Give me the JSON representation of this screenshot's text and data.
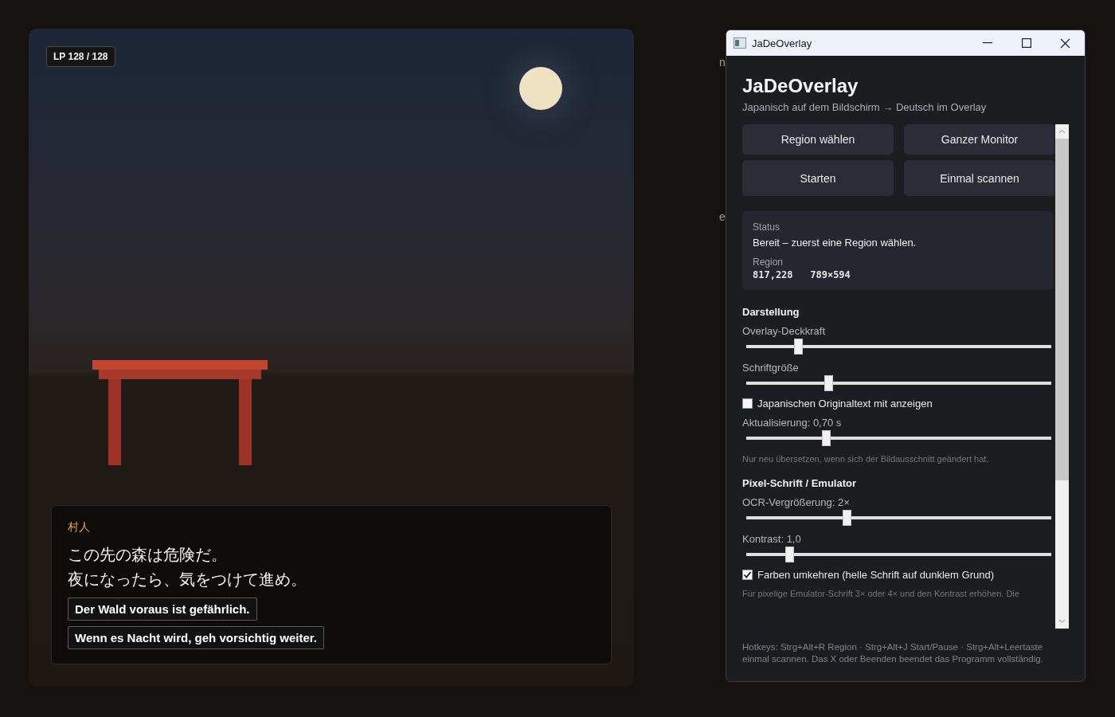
{
  "game": {
    "hp_badge": "LP 128 / 128",
    "dialog": {
      "speaker": "村人",
      "lines": [
        "この先の森は危険だ。",
        "夜になったら、気をつけて進め。"
      ],
      "translations": [
        "Der Wald voraus ist gefährlich.",
        "Wenn es Nacht wird, geh vorsichtig weiter."
      ]
    }
  },
  "background_fragments": [
    "n",
    "e"
  ],
  "window": {
    "title": "JaDeOverlay",
    "app_title": "JaDeOverlay",
    "subtitle": "Japanisch auf dem Bildschirm → Deutsch im Overlay",
    "buttons": [
      "Region wählen",
      "Ganzer Monitor",
      "Starten",
      "Einmal scannen"
    ],
    "status": {
      "status_label": "Status",
      "status_value": "Bereit – zuerst eine Region wählen.",
      "region_label": "Region",
      "region_value": "817,228   789×594"
    },
    "sections": [
      {
        "title": "Darstellung",
        "items": [
          {
            "kind": "slider",
            "label": "Overlay-Deckkraft",
            "level": 0.17
          },
          {
            "kind": "slider",
            "label": "Schriftgröße",
            "level": 0.27
          },
          {
            "kind": "checkbox",
            "label": "Japanischen Originaltext mit anzeigen",
            "checked": false
          },
          {
            "kind": "slider",
            "label": "Aktualisierung: 0,70 s",
            "level": 0.26
          },
          {
            "kind": "hint",
            "label": "Nur neu übersetzen, wenn sich der Bildausschnitt geändert hat."
          }
        ]
      },
      {
        "title": "Pixel-Schrift / Emulator",
        "items": [
          {
            "kind": "slider",
            "label": "OCR-Vergrößerung: 2×",
            "level": 0.33
          },
          {
            "kind": "slider",
            "label": "Kontrast: 1,0",
            "level": 0.14
          },
          {
            "kind": "checkbox",
            "label": "Farben umkehren (helle Schrift auf dunklem Grund)",
            "checked": true
          },
          {
            "kind": "hint",
            "label": "Für pixelige Emulator-Schrift 3× oder 4× und den Kontrast erhöhen. Die"
          }
        ]
      }
    ],
    "footer": "Hotkeys: Strg+Alt+R Region  ·  Strg+Alt+J Start/Pause  ·  Strg+Alt+Leertaste einmal scannen. Das X oder Beenden beendet das Programm vollständig."
  }
}
